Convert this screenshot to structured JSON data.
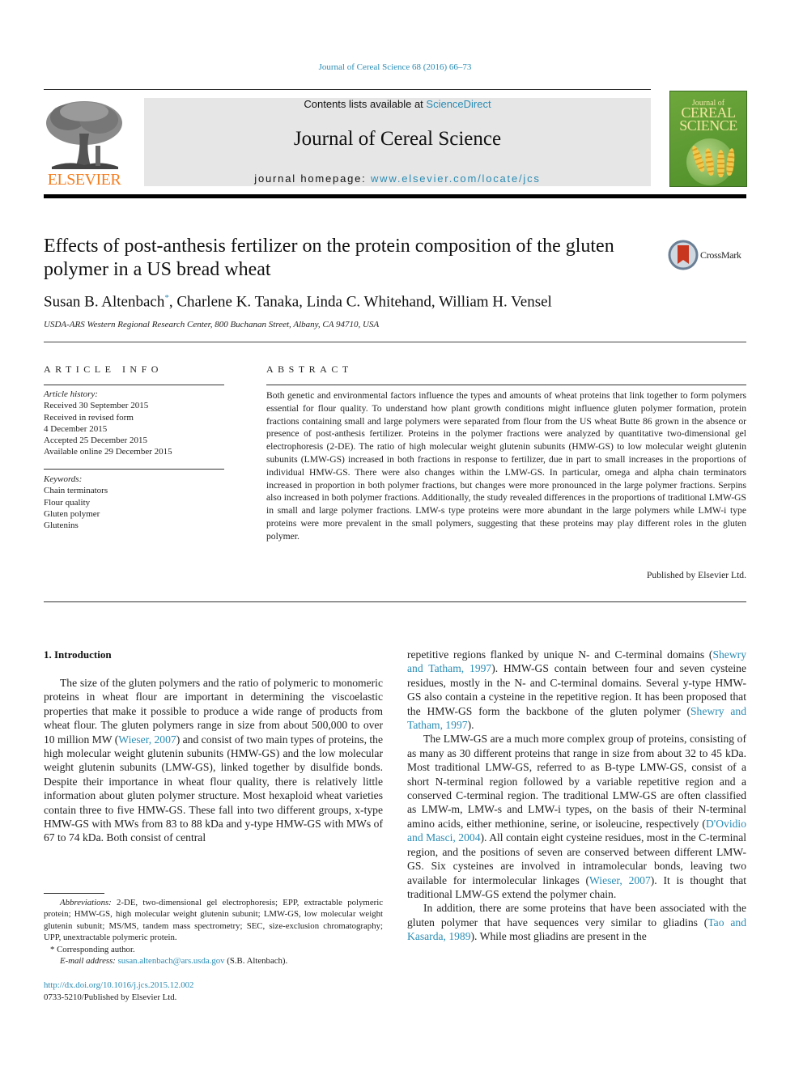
{
  "header": {
    "journal_reference": "Journal of Cereal Science 68 (2016) 66–73",
    "contents_prefix": "Contents lists available at ",
    "contents_link": "ScienceDirect",
    "journal_title": "Journal of Cereal Science",
    "homepage_prefix": "journal homepage: ",
    "homepage_link": "www.elsevier.com/locate/jcs",
    "publisher_logo_text": "ELSEVIER",
    "cover": {
      "line1": "Journal of",
      "line2": "CEREAL",
      "line3": "SCIENCE"
    },
    "colors": {
      "link": "#2a8cb4",
      "elsevier_orange": "#f47e20",
      "masthead_gray": "#e6e6e6",
      "cover_green": "#5c9a33"
    }
  },
  "article": {
    "title": "Effects of post-anthesis fertilizer on the protein composition of the gluten polymer in a US bread wheat",
    "crossmark_label": "CrossMark",
    "authors": {
      "first": "Susan B. Altenbach",
      "first_mark": "*",
      "rest": ", Charlene K. Tanaka, Linda C. Whitehand, William H. Vensel"
    },
    "affiliation": "USDA-ARS Western Regional Research Center, 800 Buchanan Street, Albany, CA 94710, USA"
  },
  "article_info": {
    "heading": "ARTICLE INFO",
    "history_label": "Article history:",
    "history": [
      "Received 30 September 2015",
      "Received in revised form",
      "4 December 2015",
      "Accepted 25 December 2015",
      "Available online 29 December 2015"
    ],
    "keywords_label": "Keywords:",
    "keywords": [
      "Chain terminators",
      "Flour quality",
      "Gluten polymer",
      "Glutenins"
    ]
  },
  "abstract": {
    "heading": "ABSTRACT",
    "body": "Both genetic and environmental factors influence the types and amounts of wheat proteins that link together to form polymers essential for flour quality. To understand how plant growth conditions might influence gluten polymer formation, protein fractions containing small and large polymers were separated from flour from the US wheat Butte 86 grown in the absence or presence of post-anthesis fertilizer. Proteins in the polymer fractions were analyzed by quantitative two-dimensional gel electrophoresis (2-DE). The ratio of high molecular weight glutenin subunits (HMW-GS) to low molecular weight glutenin subunits (LMW-GS) increased in both fractions in response to fertilizer, due in part to small increases in the proportions of individual HMW-GS. There were also changes within the LMW-GS. In particular, omega and alpha chain terminators increased in proportion in both polymer fractions, but changes were more pronounced in the large polymer fractions. Serpins also increased in both polymer fractions. Additionally, the study revealed differences in the proportions of traditional LMW-GS in small and large polymer fractions. LMW-s type proteins were more abundant in the large polymers while LMW-i type proteins were more prevalent in the small polymers, suggesting that these proteins may play different roles in the gluten polymer.",
    "publisher_note": "Published by Elsevier Ltd."
  },
  "introduction": {
    "heading": "1.  Introduction",
    "left_para1": [
      {
        "t": "The size of the gluten polymers and the ratio of polymeric to monomeric proteins in wheat flour are important in determining the viscoelastic properties that make it possible to produce a wide range of products from wheat flour. The gluten polymers range in size from about 500,000 to over 10 million MW ("
      },
      {
        "t": "Wieser, 2007",
        "link": true
      },
      {
        "t": ") and consist of two main types of proteins, the high molecular weight glutenin subunits (HMW-GS) and the low molecular weight glutenin subunits (LMW-GS), linked together by disulfide bonds. Despite their importance in wheat flour quality, there is relatively little information about gluten polymer structure. Most hexaploid wheat varieties contain three to five HMW-GS. These fall into two different groups, x-type HMW-GS with MWs from 83 to 88 kDa and y-type HMW-GS with MWs of 67 to 74 kDa. Both consist of central"
      }
    ],
    "right_para1": [
      {
        "t": "repetitive regions flanked by unique N- and C-terminal domains ("
      },
      {
        "t": "Shewry and Tatham, 1997",
        "link": true
      },
      {
        "t": "). HMW-GS contain between four and seven cysteine residues, mostly in the N- and C-terminal domains. Several y-type HMW-GS also contain a cysteine in the repetitive region. It has been proposed that the HMW-GS form the backbone of the gluten polymer ("
      },
      {
        "t": "Shewry and Tatham, 1997",
        "link": true
      },
      {
        "t": ")."
      }
    ],
    "right_para2": [
      {
        "t": "The LMW-GS are a much more complex group of proteins, consisting of as many as 30 different proteins that range in size from about 32 to 45 kDa. Most traditional LMW-GS, referred to as B-type LMW-GS, consist of a short N-terminal region followed by a variable repetitive region and a conserved C-terminal region. The traditional LMW-GS are often classified as LMW-m, LMW-s and LMW-i types, on the basis of their N-terminal amino acids, either methionine, serine, or isoleucine, respectively ("
      },
      {
        "t": "D'Ovidio and Masci, 2004",
        "link": true
      },
      {
        "t": "). All contain eight cysteine residues, most in the C-terminal region, and the positions of seven are conserved between different LMW-GS. Six cysteines are involved in intramolecular bonds, leaving two available for intermolecular linkages ("
      },
      {
        "t": "Wieser, 2007",
        "link": true
      },
      {
        "t": "). It is thought that traditional LMW-GS extend the polymer chain."
      }
    ],
    "right_para3": [
      {
        "t": "In addition, there are some proteins that have been associated with the gluten polymer that have sequences very similar to gliadins ("
      },
      {
        "t": "Tao and Kasarda, 1989",
        "link": true
      },
      {
        "t": "). While most gliadins are present in the"
      }
    ]
  },
  "footnotes": {
    "abbrev_label": "Abbreviations:",
    "abbrev_text": " 2-DE, two-dimensional gel electrophoresis; EPP, extractable polymeric protein; HMW-GS, high molecular weight glutenin subunit; LMW-GS, low molecular weight glutenin subunit; MS/MS, tandem mass spectrometry; SEC, size-exclusion chromatography; UPP, unextractable polymeric protein.",
    "corresponding": "* Corresponding author.",
    "email_label": "E-mail address:",
    "email": "susan.altenbach@ars.usda.gov",
    "email_suffix": " (S.B. Altenbach).",
    "doi": "http://dx.doi.org/10.1016/j.jcs.2015.12.002",
    "issn_line": "0733-5210/Published by Elsevier Ltd."
  }
}
